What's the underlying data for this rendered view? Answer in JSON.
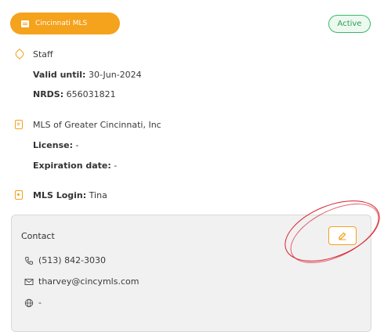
{
  "badge": {
    "label": "Cincinnati MLS"
  },
  "status": {
    "label": "Active"
  },
  "membership": {
    "type": "Staff",
    "valid_until_label": "Valid until:",
    "valid_until_value": "30-Jun-2024",
    "nrds_label": "NRDS:",
    "nrds_value": "656031821"
  },
  "organization": {
    "name": "MLS of Greater Cincinnati, Inc",
    "license_label": "License:",
    "license_value": "-",
    "expiration_label": "Expiration date:",
    "expiration_value": "-"
  },
  "mls_login": {
    "label": "MLS Login:",
    "value": "Tina"
  },
  "contact": {
    "title": "Contact",
    "phone": "(513) 842-3030",
    "email": "tharvey@cincymls.com",
    "website": "-"
  },
  "colors": {
    "accent": "#f5a21c",
    "active_green": "#3cb86a",
    "annotation_red": "#d81e2b"
  }
}
